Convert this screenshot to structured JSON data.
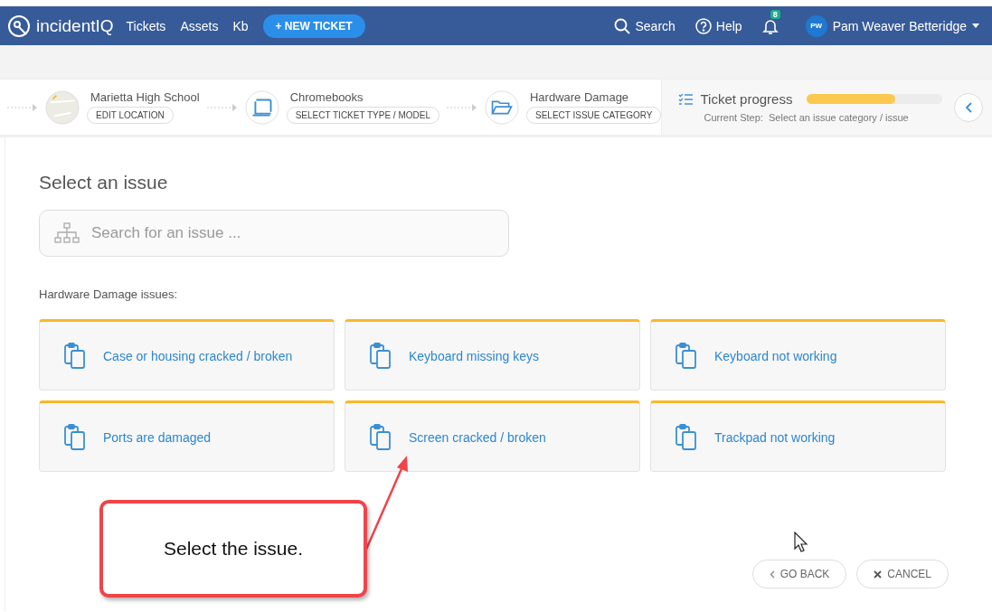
{
  "nav": {
    "logo": "incidentIQ",
    "links": [
      {
        "label": "Tickets"
      },
      {
        "label": "Assets"
      },
      {
        "label": "Kb"
      }
    ],
    "new_ticket": "+ NEW TICKET",
    "search": "Search",
    "help": "Help",
    "notifications": "8",
    "user_initials": "PW",
    "user_name": "Pam Weaver Betteridge"
  },
  "steps": [
    {
      "kind": "map",
      "title": "Marietta High School",
      "button": "EDIT LOCATION"
    },
    {
      "kind": "laptop",
      "title": "Chromebooks",
      "button": "SELECT TICKET TYPE / MODEL"
    },
    {
      "kind": "folder",
      "title": "Hardware Damage",
      "button": "SELECT ISSUE CATEGORY"
    }
  ],
  "progress": {
    "title": "Ticket progress",
    "level": 0.65,
    "current_step_label": "Current Step:",
    "current_step": "Select an issue category / issue"
  },
  "heading": "Select an issue",
  "search": {
    "placeholder": "Search for an issue ..."
  },
  "issues_label": "Hardware Damage issues:",
  "issues": [
    {
      "label": "Case or housing cracked / broken"
    },
    {
      "label": "Keyboard missing keys"
    },
    {
      "label": "Keyboard not working"
    },
    {
      "label": "Ports are damaged"
    },
    {
      "label": "Screen cracked / broken"
    },
    {
      "label": "Trackpad not working"
    }
  ],
  "buttons": {
    "back": "GO BACK",
    "cancel": "CANCEL"
  },
  "callout": "Select the issue."
}
